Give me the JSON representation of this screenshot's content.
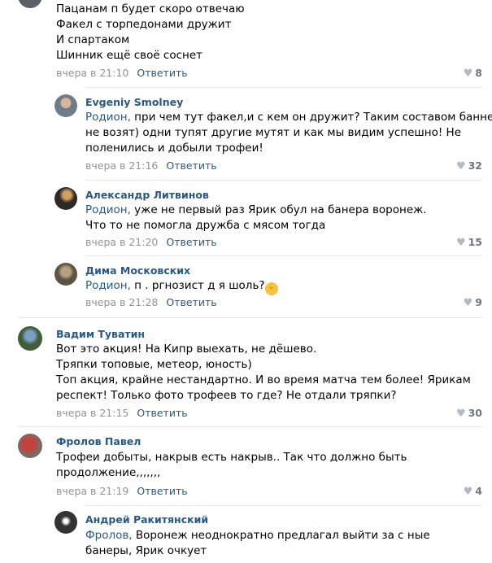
{
  "comments": [
    {
      "author": "",
      "lines": [
        "Пацанам п       будет скоро отвечаю",
        "Факел с торпедонами дружит",
        "И спартаком",
        "Шинник ещё своё соснет"
      ],
      "time": "вчера в 21:10",
      "reply_label": "Ответить",
      "likes": "8"
    },
    {
      "author": "Evgeniy Smolney",
      "reply_to": "Родион,",
      "lines": [
        " при чем тут факел,и с кем он дружит? Таким составом баннер",
        "не возят) одни тупят другие мутят и как мы видим успешно! Не",
        "поленились и добыли трофеи!"
      ],
      "time": "вчера в 21:16",
      "reply_label": "Ответить",
      "likes": "32"
    },
    {
      "author": "Александр Литвинов",
      "reply_to": "Родион,",
      "lines": [
        " уже не первый раз Ярик обул на банера воронеж.",
        "Что то не помогла дружба с мясом тогда"
      ],
      "time": "вчера в 21:20",
      "reply_label": "Ответить",
      "likes": "15"
    },
    {
      "author": "Дима Московских",
      "reply_to": "Родион,",
      "lines": [
        " п      .     ргнозист д      я шоль?"
      ],
      "emoji": "😆",
      "time": "вчера в 21:28",
      "reply_label": "Ответить",
      "likes": "9"
    },
    {
      "author": "Вадим Туватин",
      "lines": [
        "Вот это акция! На Кипр выехать, не дёшево.",
        "Тряпки топовые, метеор, юность)",
        "Топ акция, крайне нестандартно. И во время матча тем более! Ярикам",
        "респект! Только фото трофеев то где? Не отдали тряпки?"
      ],
      "time": "вчера в 21:15",
      "reply_label": "Ответить",
      "likes": "30"
    },
    {
      "author": "Фролов Павел",
      "lines": [
        "Трофеи добыты, накрыв есть накрыв.. Так что должно быть",
        "продолжение,,,,,,,"
      ],
      "time": "вчера в 21:19",
      "reply_label": "Ответить",
      "likes": "4"
    },
    {
      "author": "Андрей Ракитянский",
      "reply_to": "Фролов,",
      "lines": [
        " Воронеж неоднократно предлагал выйти за с             ные",
        "банеры, Ярик очкует"
      ]
    }
  ],
  "icons": {
    "like": "heart-icon"
  },
  "colors": {
    "link": "#2a5885",
    "meta": "#939393",
    "separator": "#e7e8ec"
  }
}
